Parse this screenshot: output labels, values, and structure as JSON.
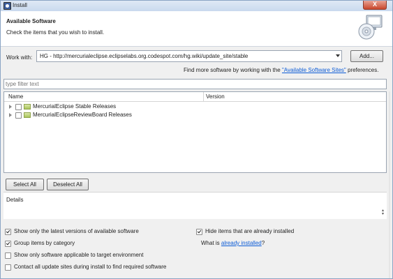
{
  "window": {
    "title": "Install",
    "close_symbol": "X"
  },
  "header": {
    "title": "Available Software",
    "subtitle": "Check the items that you wish to install."
  },
  "work_with": {
    "label": "Work with:",
    "value": "HG - http://mercurialeclipse.eclipselabs.org.codespot.com/hg.wiki/update_site/stable",
    "add_button": "Add..."
  },
  "find_more": {
    "prefix": "Find more software by working with the ",
    "link": "\"Available Software Sites\"",
    "suffix": " preferences."
  },
  "filter": {
    "placeholder": "type filter text"
  },
  "tree": {
    "columns": {
      "name": "Name",
      "version": "Version"
    },
    "items": [
      {
        "label": "MercurialEclipse Stable Releases",
        "checked": false
      },
      {
        "label": "MercurialEclipseReviewBoard Releases",
        "checked": false
      }
    ]
  },
  "buttons": {
    "select_all": "Select All",
    "deselect_all": "Deselect All"
  },
  "details": {
    "label": "Details"
  },
  "options": {
    "latest_versions": {
      "label": "Show only the latest versions of available software",
      "checked": true
    },
    "group_by_category": {
      "label": "Group items by category",
      "checked": true
    },
    "target_env": {
      "label": "Show only software applicable to target environment",
      "checked": false
    },
    "contact_sites": {
      "label": "Contact all update sites during install to find required software",
      "checked": false
    },
    "hide_installed": {
      "label": "Hide items that are already installed",
      "checked": true
    },
    "what_is": {
      "prefix": "What is ",
      "link": "already installed",
      "suffix": "?"
    }
  },
  "colors": {
    "accent": "#0b5bd6",
    "titlebar": "#c9d9ee"
  }
}
